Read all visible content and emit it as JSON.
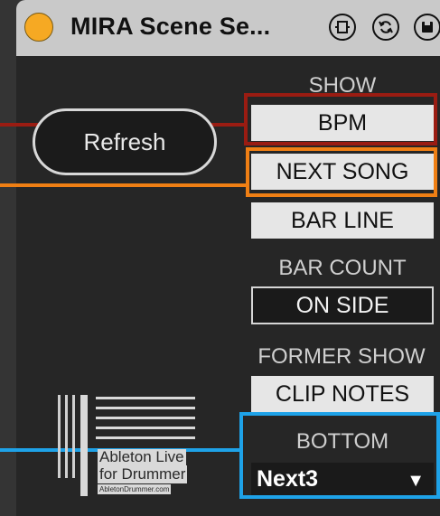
{
  "window": {
    "title": "MIRA Scene Se..."
  },
  "toolbar": {
    "buttons": [
      {
        "icon": "pin-icon"
      },
      {
        "icon": "refresh-cycle-icon"
      },
      {
        "icon": "save-icon"
      }
    ]
  },
  "refresh": {
    "label": "Refresh"
  },
  "show": {
    "label": "SHOW",
    "bpm": "BPM",
    "next_song": "NEXT SONG",
    "bar_line": "BAR LINE"
  },
  "bar_count": {
    "label": "BAR COUNT",
    "value": "ON SIDE"
  },
  "former_show": {
    "label": "FORMER SHOW",
    "clip_notes": "CLIP NOTES"
  },
  "bottom": {
    "label": "BOTTOM",
    "selected": "Next3",
    "arrow": "▼"
  },
  "logo": {
    "line1": "Ableton Live",
    "line2": "for Drummer",
    "line3": "AbletonDrummer.com"
  },
  "colors": {
    "accent_power": "#f6a923",
    "highlight_red": "#9a1c12",
    "highlight_orange": "#ef7f14",
    "highlight_blue": "#1ea2e8"
  }
}
